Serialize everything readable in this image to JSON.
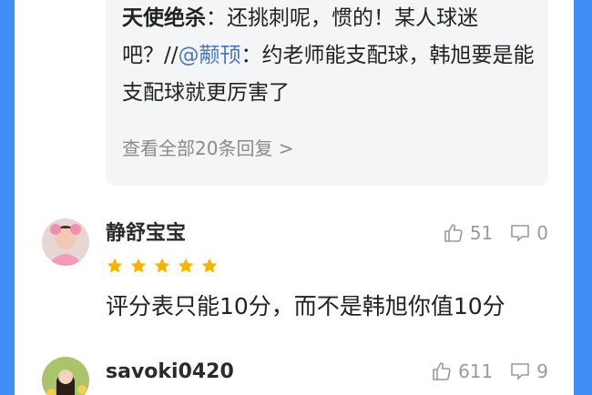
{
  "reply": {
    "author": "天使绝杀",
    "text_before_mention": "：还挑刺呢，惯的！某人球迷吧？//",
    "mention": "@颟顸",
    "text_after_mention": "：约老师能支配球，韩旭要是能支配球就更厉害了",
    "view_all": "查看全部20条回复 >"
  },
  "comments": [
    {
      "username": "静舒宝宝",
      "likes": "51",
      "replies": "0",
      "rating_stars": 5,
      "text": "评分表只能10分，而不是韩旭你值10分"
    },
    {
      "username": "savoki0420",
      "likes": "611",
      "replies": "9"
    }
  ],
  "colors": {
    "frame": "#3f8ef5",
    "star": "#f5b400",
    "mention": "#4a78b8"
  }
}
